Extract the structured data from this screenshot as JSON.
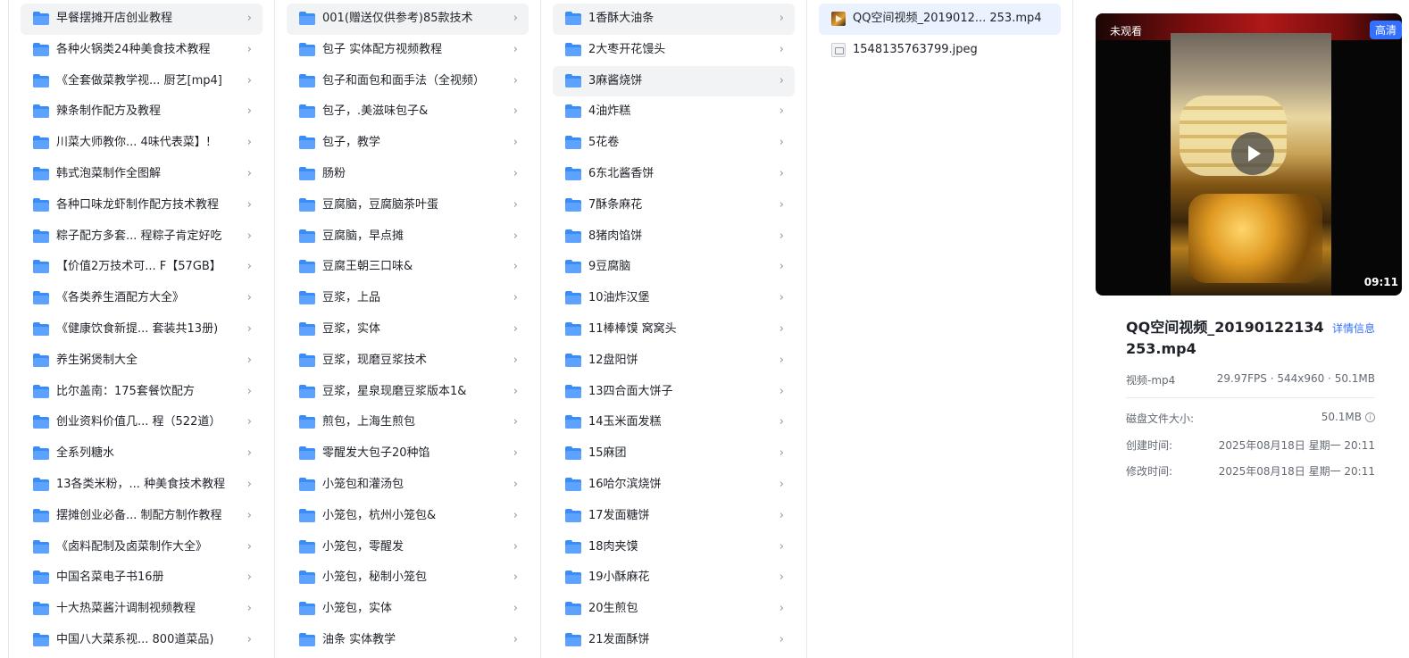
{
  "col1": {
    "items": [
      "早餐摆摊开店创业教程",
      "各种火锅类24种美食技术教程",
      "《全套做菜教学视... 厨艺[mp4]",
      "辣条制作配方及教程",
      "川菜大师教你... 4味代表菜】!",
      "韩式泡菜制作全图解",
      "各种口味龙虾制作配方技术教程",
      "粽子配方多套... 程粽子肯定好吃",
      "【价值2万技术可... F【57GB】",
      "《各类养生酒配方大全》",
      "《健康饮食新提... 套装共13册)",
      "养生粥煲制大全",
      "比尔盖南：175套餐饮配方",
      "创业资料价值几... 程（522道）",
      "全系列糖水",
      "13各类米粉，... 种美食技术教程",
      "摆摊创业必备... 制配方制作教程",
      "《卤料配制及卤菜制作大全》",
      "中国名菜电子书16册",
      "十大热菜酱汁调制视频教程",
      "中国八大菜系视... 800道菜品)"
    ]
  },
  "col2": {
    "items": [
      "001(赠送仅供参考)85款技术",
      "包子 实体配方视频教程",
      "包子和面包和面手法（全视频）",
      "包子，.美滋味包子&",
      "包子，教学",
      "肠粉",
      "豆腐脑，豆腐脑茶叶蛋",
      "豆腐脑，早点摊",
      "豆腐王朝三口味&",
      "豆浆，上品",
      "豆浆，实体",
      "豆浆，现磨豆浆技术",
      "豆浆，星泉现磨豆浆版本1&",
      "煎包，上海生煎包",
      "零醒发大包子20种馅",
      "小笼包和灌汤包",
      "小笼包，杭州小笼包&",
      "小笼包，零醒发",
      "小笼包，秘制小笼包",
      "小笼包，实体",
      "油条 实体教学"
    ]
  },
  "col3": {
    "items": [
      "1香酥大油条",
      "2大枣开花馒头",
      "3麻酱烧饼",
      "4油炸糕",
      "5花卷",
      "6东北酱香饼",
      "7酥条麻花",
      "8猪肉馅饼",
      "9豆腐脑",
      "10油炸汉堡",
      "11棒棒馍 窝窝头",
      "12盘阳饼",
      "13四合面大饼子",
      "14玉米面发糕",
      "15麻团",
      "16哈尔滨烧饼",
      "17发面糖饼",
      "18肉夹馍",
      "19小酥麻花",
      "20生煎包",
      "21发面酥饼"
    ]
  },
  "col4": {
    "files": [
      {
        "name": "QQ空间视频_2019012... 253.mp4",
        "icon": "video-thumbnail-icon"
      },
      {
        "name": "1548135763799.jpeg",
        "icon": "image-file-icon"
      }
    ]
  },
  "preview": {
    "badge_unwatched": "未观看",
    "badge_quality": "高清",
    "duration": "09:11",
    "title": "QQ空间视频_20190122134253.mp4",
    "detail_link": "详情信息",
    "type_label": "视频-mp4",
    "specs": "29.97FPS · 544x960 · 50.1MB",
    "size_label": "磁盘文件大小:",
    "size_value": "50.1MB",
    "created_label": "创建时间:",
    "created_value": "2025年08月18日 星期一 20:11",
    "modified_label": "修改时间:",
    "modified_value": "2025年08月18日 星期一 20:11"
  },
  "colors": {
    "folder": "#3a8cf6",
    "accent": "#3370ff",
    "selected_grey": "#f2f3f5",
    "selected_blue": "#eaf2ff"
  }
}
